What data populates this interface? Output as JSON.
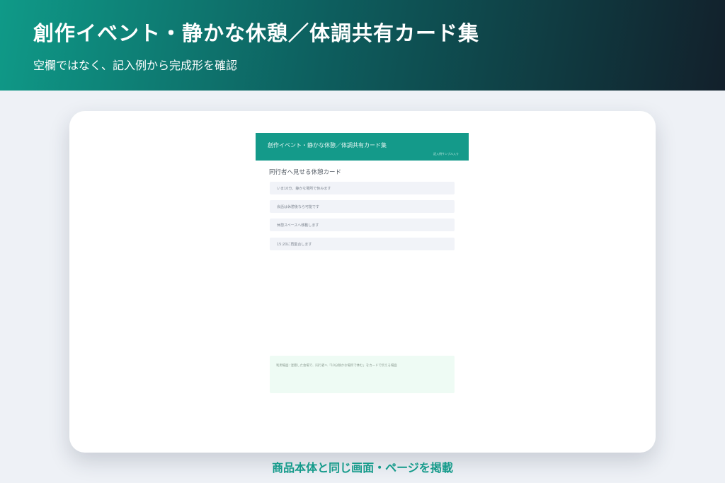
{
  "banner": {
    "title": "創作イベント・静かな休憩／体調共有カード集",
    "subtitle": "空欄ではなく、記入例から完成形を確認"
  },
  "product": {
    "title": "創作イベント・静かな休憩／体調共有カード集",
    "tag": "記入例サンプル入り",
    "section_heading": "同行者へ見せる休憩カード",
    "cards": [
      {
        "text": "いま10分、静かな場所で休みます"
      },
      {
        "text": "会話は休憩後なら可能です"
      },
      {
        "text": "休憩スペースへ移動します"
      },
      {
        "text": "15:20に再集合します"
      }
    ],
    "note": "利用場面: 混雑した会場で、同行者へ「10分静かな場所で休む」をカードで伝える場面"
  },
  "caption": "商品本体と同じ画面・ページを掲載",
  "colors": {
    "accent": "#149a8a",
    "banner_dark": "#12202b",
    "card_bg": "#f1f3f8",
    "note_bg": "#eefbf4"
  }
}
